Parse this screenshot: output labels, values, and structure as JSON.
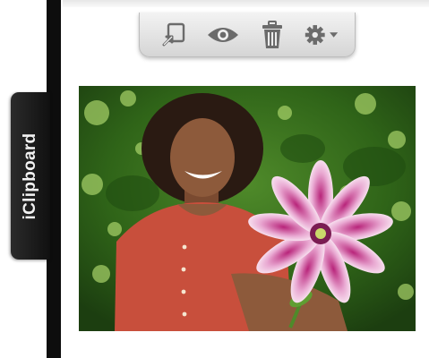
{
  "sidebar": {
    "tab_label": "iClipboard"
  },
  "toolbar": {
    "buttons": [
      {
        "icon": "paste-into-icon"
      },
      {
        "icon": "eye-icon"
      },
      {
        "icon": "trash-icon"
      },
      {
        "icon": "gear-dropdown-icon"
      }
    ]
  },
  "clip": {
    "type": "image",
    "subject": "photo"
  },
  "colors": {
    "accent_dark": "#111111",
    "toolbar_icon": "#6b6b6b"
  }
}
